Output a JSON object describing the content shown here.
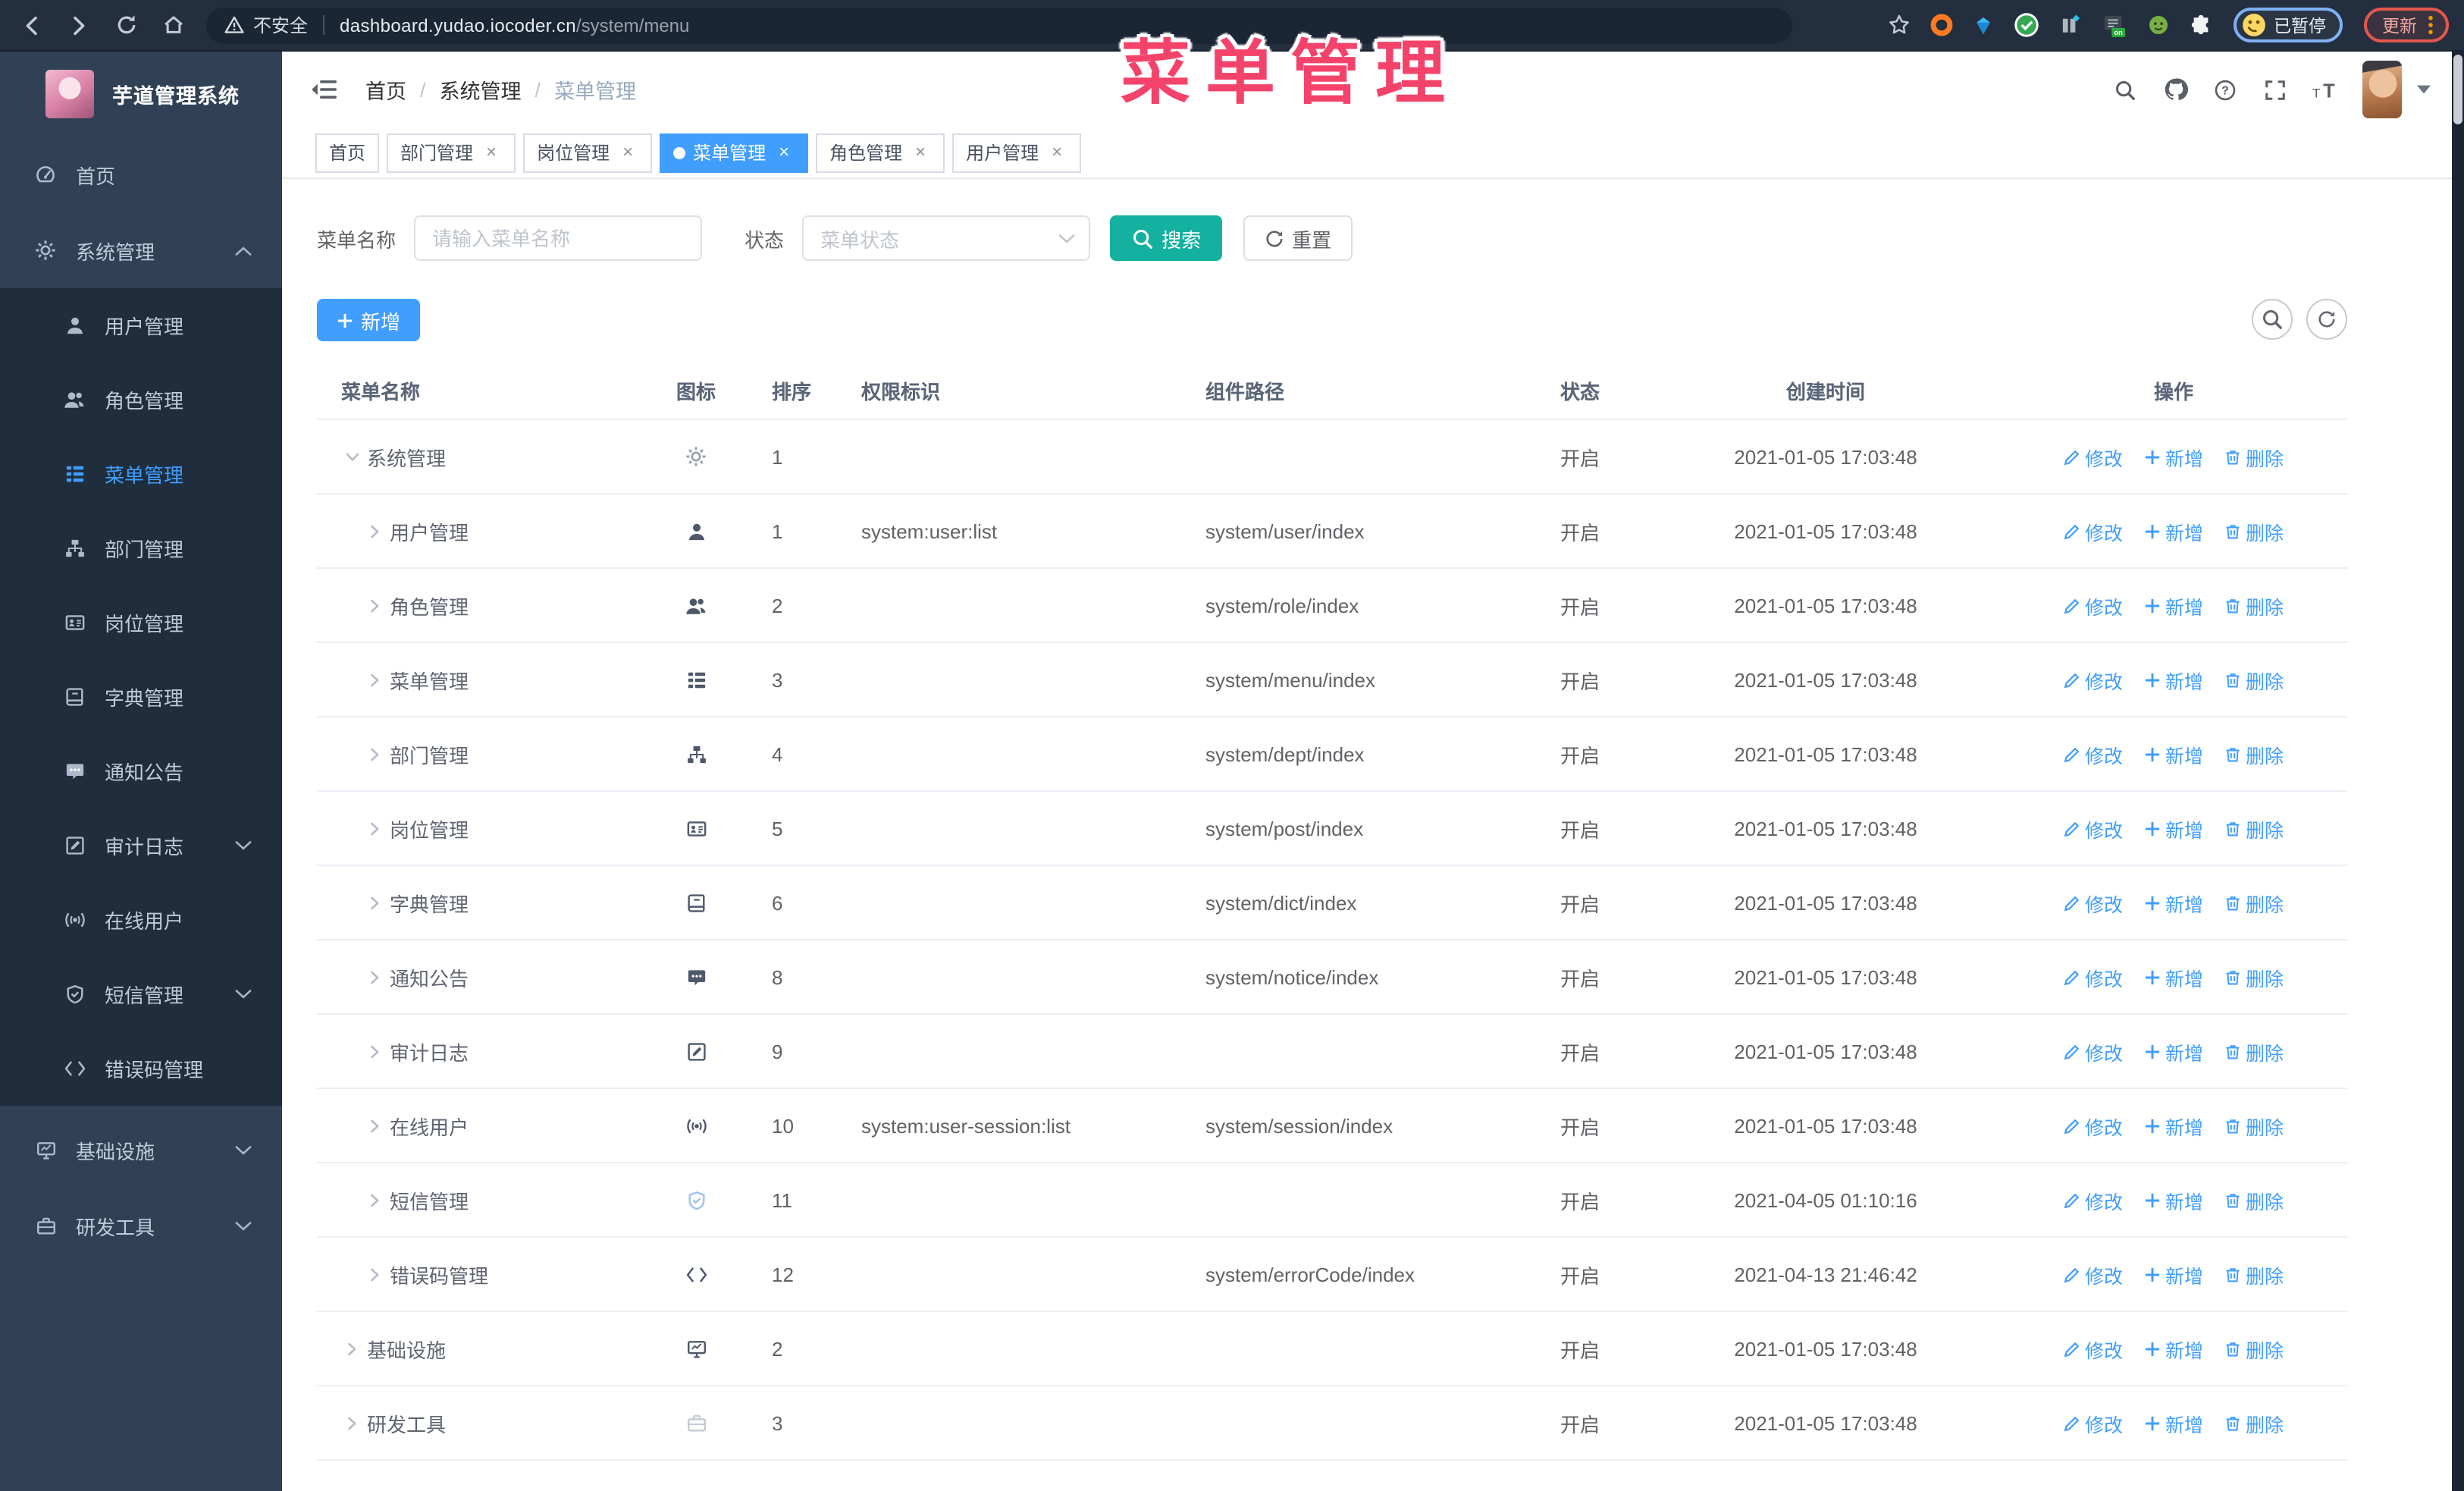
{
  "colors": {
    "accent": "#409eff",
    "search_button": "#14b1a0",
    "overlay_title": "#f4436a",
    "sidebar_bg": "#304156",
    "sidebar_submenu_bg": "#1f2d3d",
    "link": "#409eff",
    "status_text": "#606266"
  },
  "overlay_title": "菜单管理",
  "browser": {
    "security_label": "不安全",
    "url_host": "dashboard.yudao.iocoder.cn",
    "url_path": "/system/menu",
    "paused_label": "已暂停",
    "update_label": "更新",
    "extension_icons": [
      "ext-orange-ring",
      "ext-blue-gem",
      "ext-green-check",
      "ext-gray-bars",
      "ext-reader-on",
      "ext-green-face",
      "extensions-puzzle"
    ]
  },
  "sidebar": {
    "logo_title": "芋道管理系统",
    "items": [
      {
        "id": "home",
        "label": "首页",
        "icon": "dashboard",
        "level": 0
      },
      {
        "id": "system",
        "label": "系统管理",
        "icon": "gear",
        "level": 0,
        "arrow": "up",
        "open": true
      },
      {
        "id": "user",
        "label": "用户管理",
        "icon": "user",
        "level": 1
      },
      {
        "id": "role",
        "label": "角色管理",
        "icon": "users",
        "level": 1
      },
      {
        "id": "menu",
        "label": "菜单管理",
        "icon": "menu",
        "level": 1,
        "active": true
      },
      {
        "id": "dept",
        "label": "部门管理",
        "icon": "tree",
        "level": 1
      },
      {
        "id": "post",
        "label": "岗位管理",
        "icon": "idcard",
        "level": 1
      },
      {
        "id": "dict",
        "label": "字典管理",
        "icon": "dict",
        "level": 1
      },
      {
        "id": "notice",
        "label": "通知公告",
        "icon": "message",
        "level": 1
      },
      {
        "id": "audit",
        "label": "审计日志",
        "icon": "log",
        "level": 1,
        "arrow": "down"
      },
      {
        "id": "session",
        "label": "在线用户",
        "icon": "online",
        "level": 1
      },
      {
        "id": "sms",
        "label": "短信管理",
        "icon": "shield",
        "level": 1,
        "arrow": "down"
      },
      {
        "id": "errcode",
        "label": "错误码管理",
        "icon": "code",
        "level": 1
      },
      {
        "id": "infra",
        "label": "基础设施",
        "icon": "monitor",
        "level": 0,
        "arrow": "down",
        "gap": true
      },
      {
        "id": "tool",
        "label": "研发工具",
        "icon": "tool",
        "level": 0,
        "arrow": "down"
      }
    ]
  },
  "header": {
    "breadcrumb": [
      "首页",
      "系统管理",
      "菜单管理"
    ],
    "right_icons": [
      "search",
      "github",
      "question",
      "fullscreen",
      "font-size"
    ]
  },
  "tabs": [
    {
      "label": "首页",
      "closable": false,
      "active": false
    },
    {
      "label": "部门管理",
      "closable": true,
      "active": false
    },
    {
      "label": "岗位管理",
      "closable": true,
      "active": false
    },
    {
      "label": "菜单管理",
      "closable": true,
      "active": true
    },
    {
      "label": "角色管理",
      "closable": true,
      "active": false
    },
    {
      "label": "用户管理",
      "closable": true,
      "active": false
    }
  ],
  "filter": {
    "name_label": "菜单名称",
    "name_placeholder": "请输入菜单名称",
    "name_value": "",
    "status_label": "状态",
    "status_placeholder": "菜单状态",
    "search_label": "搜索",
    "reset_label": "重置"
  },
  "toolbar": {
    "add_label": "新增"
  },
  "table": {
    "columns": [
      "菜单名称",
      "图标",
      "排序",
      "权限标识",
      "组件路径",
      "状态",
      "创建时间",
      "操作"
    ],
    "action_labels": [
      "修改",
      "新增",
      "删除"
    ],
    "rows": [
      {
        "name": "系统管理",
        "icon": "gear",
        "level": 0,
        "expanded": true,
        "sort": "1",
        "permission": "",
        "component": "",
        "status": "开启",
        "created": "2021-01-05 17:03:48"
      },
      {
        "name": "用户管理",
        "icon": "user",
        "level": 1,
        "sort": "1",
        "permission": "system:user:list",
        "component": "system/user/index",
        "status": "开启",
        "created": "2021-01-05 17:03:48"
      },
      {
        "name": "角色管理",
        "icon": "users",
        "level": 1,
        "sort": "2",
        "permission": "",
        "component": "system/role/index",
        "status": "开启",
        "created": "2021-01-05 17:03:48"
      },
      {
        "name": "菜单管理",
        "icon": "menu",
        "level": 1,
        "sort": "3",
        "permission": "",
        "component": "system/menu/index",
        "status": "开启",
        "created": "2021-01-05 17:03:48"
      },
      {
        "name": "部门管理",
        "icon": "tree",
        "level": 1,
        "sort": "4",
        "permission": "",
        "component": "system/dept/index",
        "status": "开启",
        "created": "2021-01-05 17:03:48"
      },
      {
        "name": "岗位管理",
        "icon": "idcard",
        "level": 1,
        "sort": "5",
        "permission": "",
        "component": "system/post/index",
        "status": "开启",
        "created": "2021-01-05 17:03:48"
      },
      {
        "name": "字典管理",
        "icon": "dict",
        "level": 1,
        "sort": "6",
        "permission": "",
        "component": "system/dict/index",
        "status": "开启",
        "created": "2021-01-05 17:03:48"
      },
      {
        "name": "通知公告",
        "icon": "message",
        "level": 1,
        "sort": "8",
        "permission": "",
        "component": "system/notice/index",
        "status": "开启",
        "created": "2021-01-05 17:03:48"
      },
      {
        "name": "审计日志",
        "icon": "log",
        "level": 1,
        "sort": "9",
        "permission": "",
        "component": "",
        "status": "开启",
        "created": "2021-01-05 17:03:48"
      },
      {
        "name": "在线用户",
        "icon": "online",
        "level": 1,
        "sort": "10",
        "permission": "system:user-session:list",
        "component": "system/session/index",
        "status": "开启",
        "created": "2021-01-05 17:03:48"
      },
      {
        "name": "短信管理",
        "icon": "shield",
        "level": 1,
        "sort": "11",
        "permission": "",
        "component": "",
        "status": "开启",
        "created": "2021-04-05 01:10:16"
      },
      {
        "name": "错误码管理",
        "icon": "code",
        "level": 1,
        "sort": "12",
        "permission": "",
        "component": "system/errorCode/index",
        "status": "开启",
        "created": "2021-04-13 21:46:42"
      },
      {
        "name": "基础设施",
        "icon": "monitor",
        "level": 0,
        "sort": "2",
        "permission": "",
        "component": "",
        "status": "开启",
        "created": "2021-01-05 17:03:48"
      },
      {
        "name": "研发工具",
        "icon": "tool",
        "level": 0,
        "sort": "3",
        "permission": "",
        "component": "",
        "status": "开启",
        "created": "2021-01-05 17:03:48"
      }
    ]
  }
}
